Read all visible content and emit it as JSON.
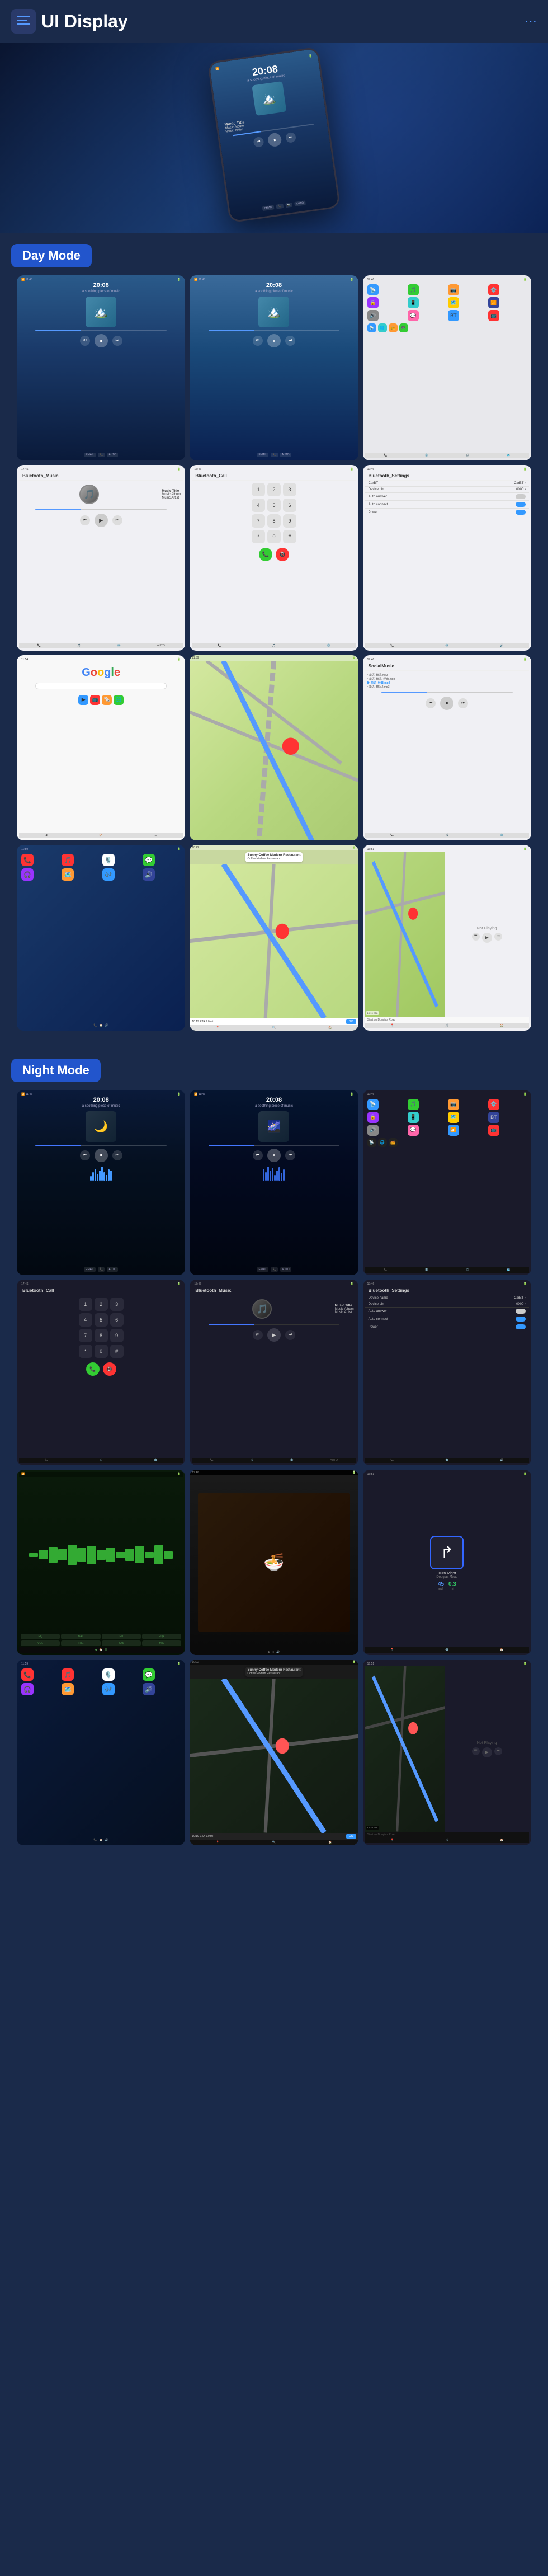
{
  "header": {
    "title": "UI Display",
    "menu_icon": "☰",
    "hamburger": "≡",
    "dots": "⋮"
  },
  "day_mode": {
    "label": "Day Mode",
    "screens": [
      {
        "id": "day-music-1",
        "type": "music",
        "time": "20:08",
        "subtitle": "a soothing piece of music"
      },
      {
        "id": "day-music-2",
        "type": "music",
        "time": "20:08",
        "subtitle": "a soothing piece of music"
      },
      {
        "id": "day-settings",
        "type": "settings"
      },
      {
        "id": "day-bluetooth-music",
        "type": "bluetooth_music",
        "header": "Bluetooth_Music"
      },
      {
        "id": "day-bluetooth-call",
        "type": "bluetooth_call",
        "header": "Bluetooth_Call"
      },
      {
        "id": "day-bluetooth-settings",
        "type": "bluetooth_settings",
        "header": "Bluetooth_Settings"
      },
      {
        "id": "day-google",
        "type": "google"
      },
      {
        "id": "day-map",
        "type": "map"
      },
      {
        "id": "day-social-music",
        "type": "social_music",
        "header": "SocialMusic"
      },
      {
        "id": "day-carplay",
        "type": "carplay"
      },
      {
        "id": "day-navigation",
        "type": "navigation"
      },
      {
        "id": "day-now-playing",
        "type": "now_playing"
      }
    ]
  },
  "night_mode": {
    "label": "Night Mode",
    "screens": [
      {
        "id": "night-music-1",
        "type": "music_night",
        "time": "20:08"
      },
      {
        "id": "night-music-2",
        "type": "music_night2",
        "time": "20:08"
      },
      {
        "id": "night-settings",
        "type": "settings_night"
      },
      {
        "id": "night-bluetooth-call",
        "type": "bluetooth_call_night",
        "header": "Bluetooth_Call"
      },
      {
        "id": "night-bluetooth-music",
        "type": "bluetooth_music_night",
        "header": "Bluetooth_Music"
      },
      {
        "id": "night-bluetooth-settings",
        "type": "bluetooth_settings_night",
        "header": "Bluetooth_Settings"
      },
      {
        "id": "night-waveform",
        "type": "waveform_night"
      },
      {
        "id": "night-video",
        "type": "video_night"
      },
      {
        "id": "night-driving",
        "type": "driving_night"
      },
      {
        "id": "night-carplay",
        "type": "carplay_night"
      },
      {
        "id": "night-navigation",
        "type": "navigation_night"
      },
      {
        "id": "night-now-playing",
        "type": "now_playing_night"
      }
    ]
  },
  "music_info": {
    "title": "Music Title",
    "album": "Music Album",
    "artist": "Music Artist"
  },
  "bt_settings": {
    "device_name": "CarBT",
    "device_pin": "0000",
    "auto_answer": "Auto answer",
    "auto_connect": "Auto connect",
    "power": "Power"
  },
  "navigation": {
    "restaurant": "Sunny Coffee Modern Restaurant",
    "address": "Coffee Modern Restaurant",
    "eta": "10:19 ETA  9.0 mi",
    "go": "GO",
    "start_on": "Start on Douglas Road",
    "not_playing": "Not Playing"
  },
  "colors": {
    "day_badge": "#2255cc",
    "night_badge": "#2255cc",
    "accent": "#3399ff",
    "bg_dark": "#1a2a4a"
  }
}
